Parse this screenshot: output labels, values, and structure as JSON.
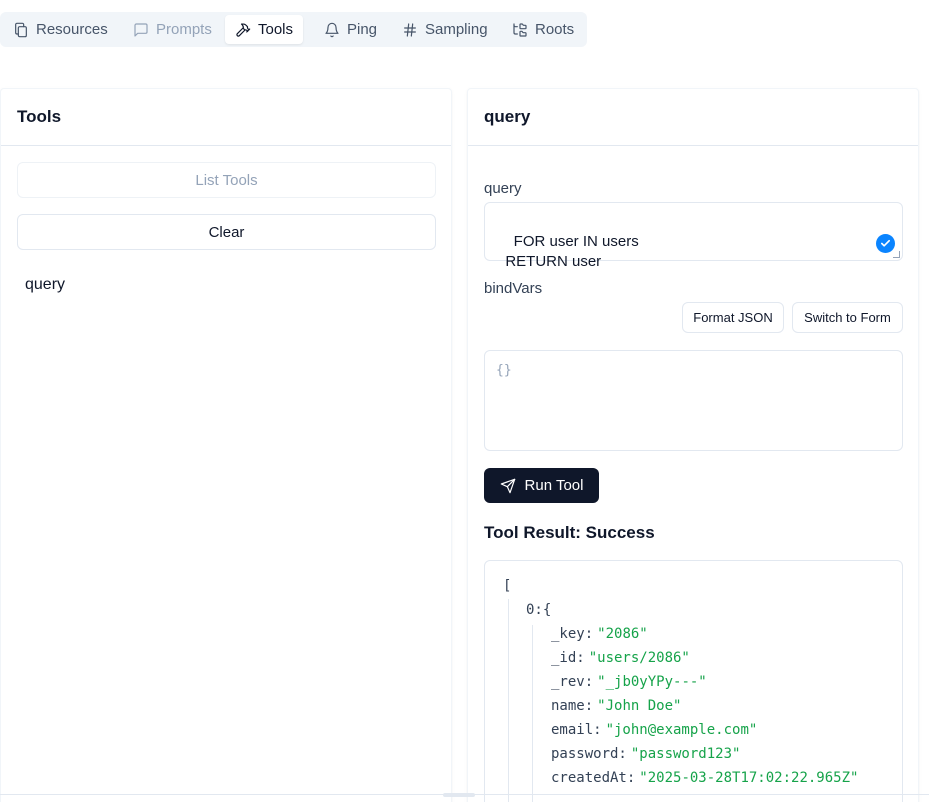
{
  "tabs": [
    {
      "label": "Resources",
      "icon": "files-icon",
      "state": "normal"
    },
    {
      "label": "Prompts",
      "icon": "message-square-icon",
      "state": "disabled"
    },
    {
      "label": "Tools",
      "icon": "hammer-icon",
      "state": "active"
    },
    {
      "label": "Ping",
      "icon": "bell-icon",
      "state": "normal"
    },
    {
      "label": "Sampling",
      "icon": "hash-icon",
      "state": "normal"
    },
    {
      "label": "Roots",
      "icon": "folder-tree-icon",
      "state": "normal"
    }
  ],
  "tools_panel": {
    "title": "Tools",
    "list_tools_label": "List Tools",
    "clear_label": "Clear",
    "items": [
      "query"
    ]
  },
  "detail_panel": {
    "title": "query",
    "query_label": "query",
    "query_value": "FOR user IN users\n  RETURN user",
    "bindvars_label": "bindVars",
    "format_json_label": "Format JSON",
    "switch_to_form_label": "Switch to Form",
    "bindvars_value": "{}",
    "run_tool_label": "Run Tool",
    "result_title": "Tool Result: Success",
    "result": {
      "open_bracket": "[",
      "index_key": "0:",
      "open_brace": "{",
      "fields": [
        {
          "key": "_key:",
          "value": "\"2086\""
        },
        {
          "key": "_id:",
          "value": "\"users/2086\""
        },
        {
          "key": "_rev:",
          "value": "\"_jb0yYPy---\""
        },
        {
          "key": "name:",
          "value": "\"John Doe\""
        },
        {
          "key": "email:",
          "value": "\"john@example.com\""
        },
        {
          "key": "password:",
          "value": "\"password123\""
        },
        {
          "key": "createdAt:",
          "value": "\"2025-03-28T17:02:22.965Z\""
        }
      ]
    }
  },
  "colors": {
    "primary": "#0f172a",
    "json_string": "#16a34a",
    "check_badge": "#0a84ff",
    "muted": "#94a3b8"
  }
}
